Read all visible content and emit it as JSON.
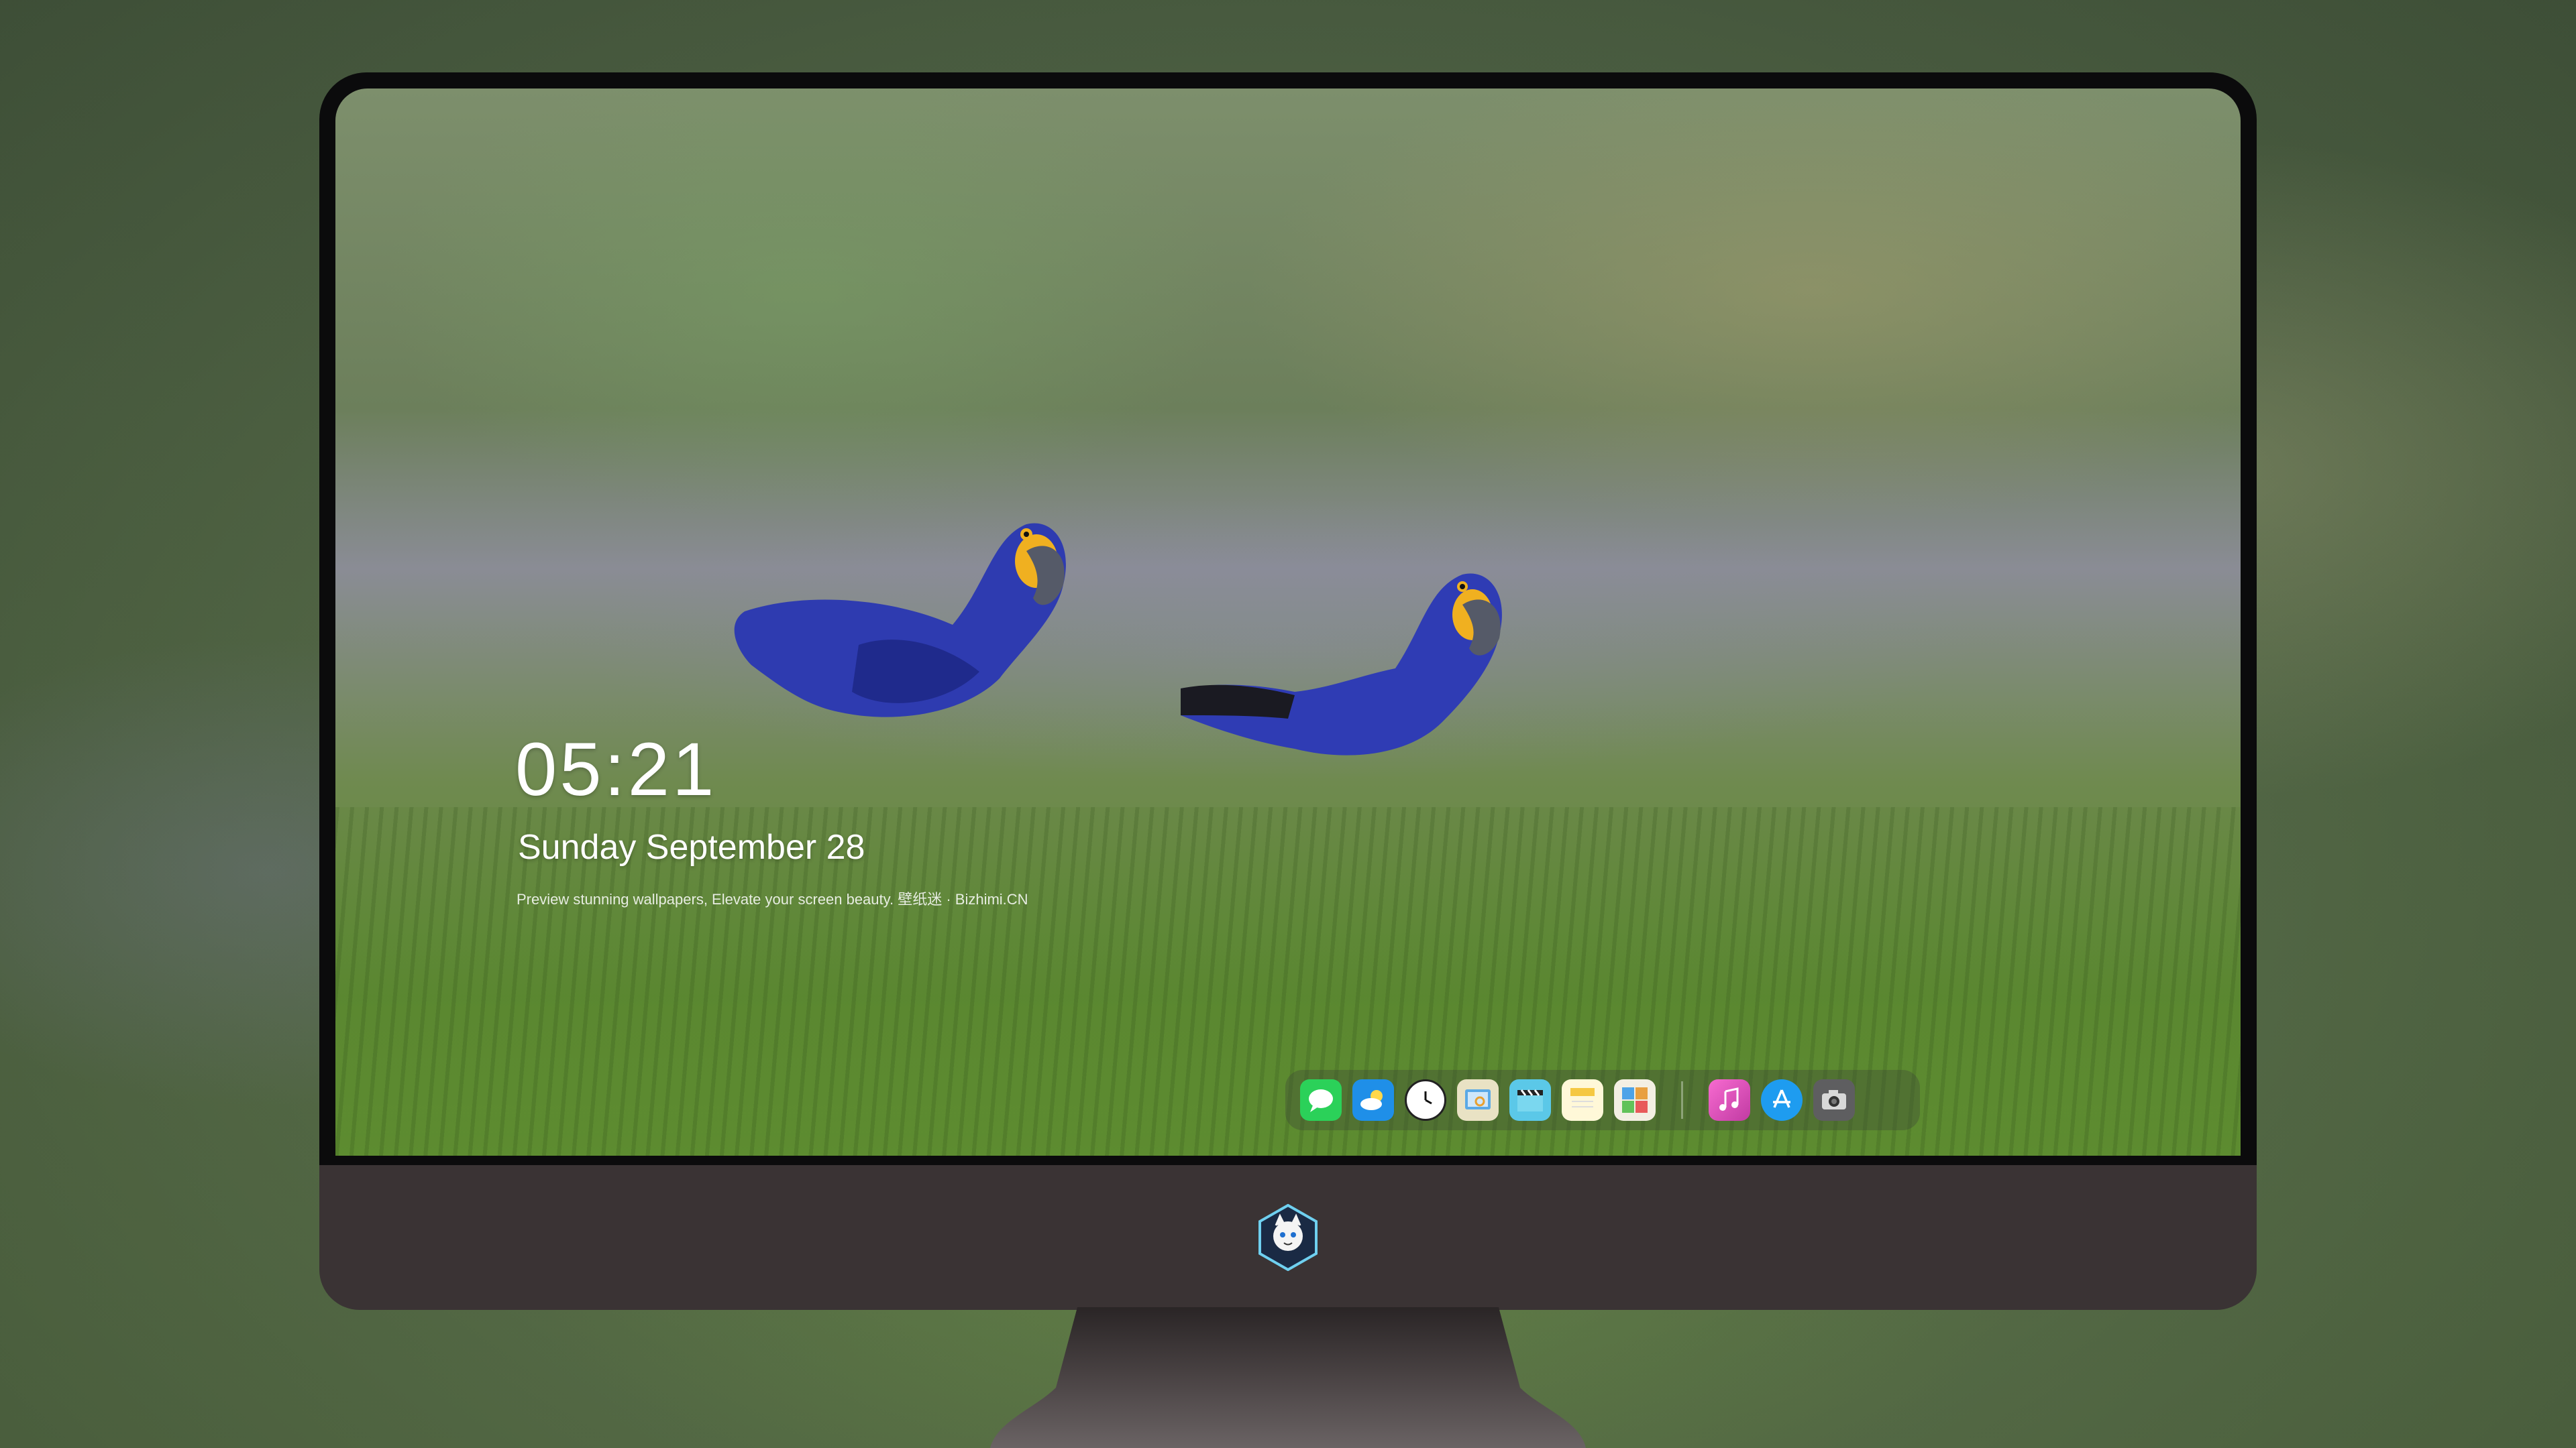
{
  "lock_screen": {
    "time": "05:21",
    "date": "Sunday September  28",
    "caption": "Preview stunning wallpapers, Elevate your screen beauty. 壁纸迷 · Bizhimi.CN"
  },
  "dock": {
    "items": [
      {
        "name": "messages",
        "icon": "chat-bubble-icon",
        "color": "#2bd159"
      },
      {
        "name": "weather",
        "icon": "cloud-sun-icon",
        "color": "#1f8fe8"
      },
      {
        "name": "clock",
        "icon": "clock-icon",
        "color": "#ffffff"
      },
      {
        "name": "preview",
        "icon": "photo-viewer-icon",
        "color": "#f0d060"
      },
      {
        "name": "video",
        "icon": "clapperboard-icon",
        "color": "#5bc8e8"
      },
      {
        "name": "notes",
        "icon": "notes-icon",
        "color": "#f5d66a"
      },
      {
        "name": "photo-booth",
        "icon": "photo-collage-icon",
        "color": "#e8a040"
      },
      {
        "name": "music",
        "icon": "music-note-icon",
        "color": "#ee4fb4"
      },
      {
        "name": "app-store",
        "icon": "app-store-icon",
        "color": "#1e9cf0"
      },
      {
        "name": "camera",
        "icon": "camera-icon",
        "color": "#6b6b6b"
      }
    ]
  },
  "colors": {
    "bezel": "#0b0b0c",
    "chin": "#3a3334",
    "stand": "#3b3536"
  }
}
